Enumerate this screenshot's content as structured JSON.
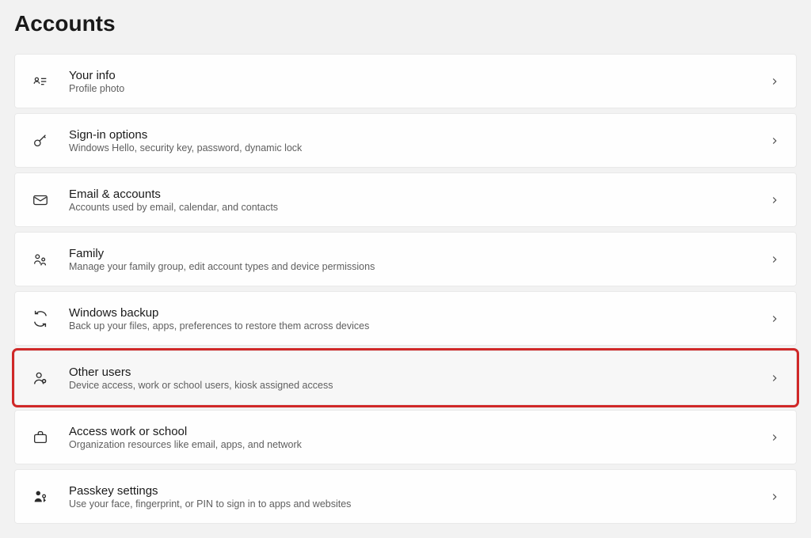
{
  "header": {
    "title": "Accounts"
  },
  "items": [
    {
      "icon": "contact-card-icon",
      "title": "Your info",
      "subtitle": "Profile photo",
      "highlighted": false
    },
    {
      "icon": "key-icon",
      "title": "Sign-in options",
      "subtitle": "Windows Hello, security key, password, dynamic lock",
      "highlighted": false
    },
    {
      "icon": "mail-icon",
      "title": "Email & accounts",
      "subtitle": "Accounts used by email, calendar, and contacts",
      "highlighted": false
    },
    {
      "icon": "family-icon",
      "title": "Family",
      "subtitle": "Manage your family group, edit account types and device permissions",
      "highlighted": false
    },
    {
      "icon": "backup-icon",
      "title": "Windows backup",
      "subtitle": "Back up your files, apps, preferences to restore them across devices",
      "highlighted": false
    },
    {
      "icon": "person-add-icon",
      "title": "Other users",
      "subtitle": "Device access, work or school users, kiosk assigned access",
      "highlighted": true
    },
    {
      "icon": "briefcase-icon",
      "title": "Access work or school",
      "subtitle": "Organization resources like email, apps, and network",
      "highlighted": false
    },
    {
      "icon": "passkey-icon",
      "title": "Passkey settings",
      "subtitle": "Use your face, fingerprint, or PIN to sign in to apps and websites",
      "highlighted": false
    }
  ]
}
